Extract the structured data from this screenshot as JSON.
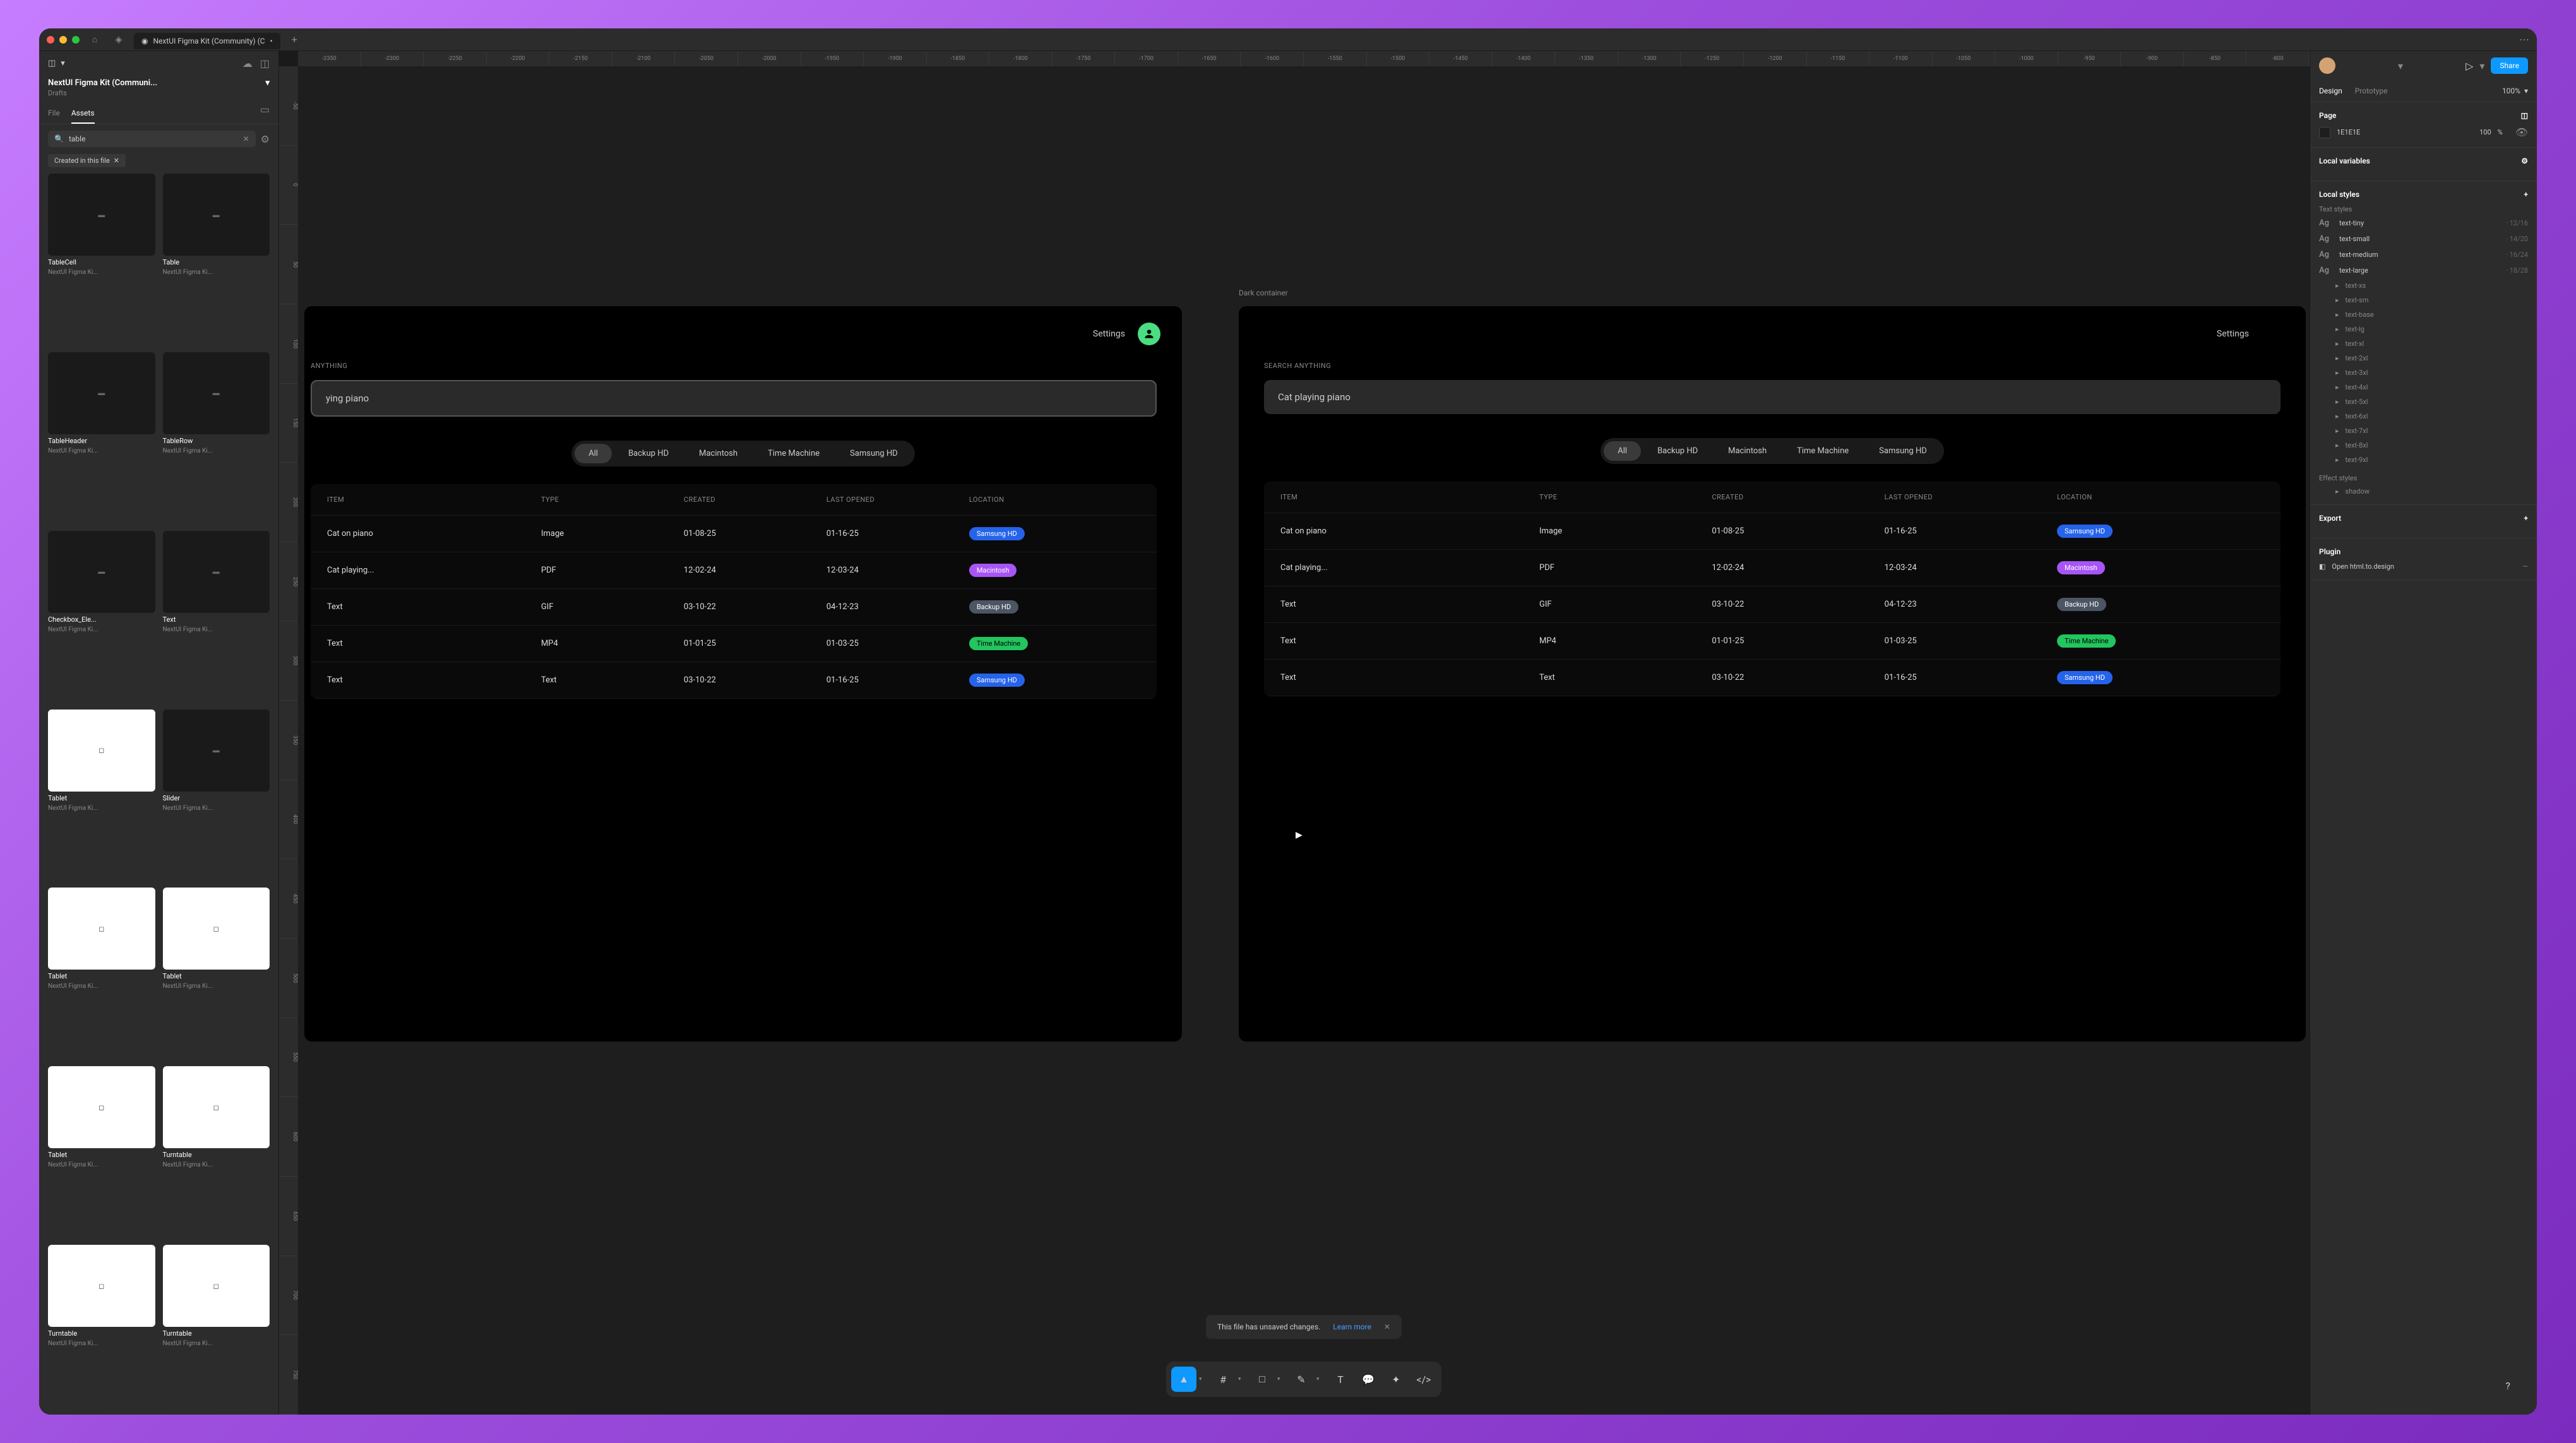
{
  "titlebar": {
    "tab_name": "NextUI Figma Kit (Community) (C",
    "tab_modified": "•"
  },
  "left_panel": {
    "project_name": "NextUI Figma Kit (Communi...",
    "project_location": "Drafts",
    "tabs": [
      "File",
      "Assets"
    ],
    "active_tab": 1,
    "search_value": "table",
    "chip": "Created in this file",
    "assets": [
      {
        "name": "TableCell",
        "sub": "NextUI Figma Ki...",
        "dark": true
      },
      {
        "name": "Table",
        "sub": "NextUI Figma Ki...",
        "dark": true
      },
      {
        "name": "TableHeader",
        "sub": "NextUI Figma Ki...",
        "dark": true
      },
      {
        "name": "TableRow",
        "sub": "NextUI Figma Ki...",
        "dark": true
      },
      {
        "name": "Checkbox_Ele...",
        "sub": "NextUI Figma Ki...",
        "dark": true
      },
      {
        "name": "Text",
        "sub": "NextUI Figma Ki...",
        "dark": true
      },
      {
        "name": "Tablet",
        "sub": "NextUI Figma Ki...",
        "light": true
      },
      {
        "name": "Slider",
        "sub": "NextUI Figma Ki...",
        "dark": true
      },
      {
        "name": "Tablet",
        "sub": "NextUI Figma Ki...",
        "light": true
      },
      {
        "name": "Tablet",
        "sub": "NextUI Figma Ki...",
        "light": true
      },
      {
        "name": "Tablet",
        "sub": "NextUI Figma Ki...",
        "light": true
      },
      {
        "name": "Turntable",
        "sub": "NextUI Figma Ki...",
        "light": true
      },
      {
        "name": "Turntable",
        "sub": "NextUI Figma Ki...",
        "light": true
      },
      {
        "name": "Turntable",
        "sub": "NextUI Figma Ki...",
        "light": true
      }
    ]
  },
  "ruler_h": [
    "-2350",
    "-2300",
    "-2250",
    "-2200",
    "-2150",
    "-2100",
    "-2050",
    "-2000",
    "-1950",
    "-1900",
    "-1850",
    "-1800",
    "-1750",
    "-1700",
    "-1650",
    "-1600",
    "-1550",
    "-1500",
    "-1450",
    "-1400",
    "-1350",
    "-1300",
    "-1250",
    "-1200",
    "-1150",
    "-1100",
    "-1050",
    "-1000",
    "-950",
    "-900",
    "-850",
    "-800"
  ],
  "ruler_v": [
    "-50",
    "0",
    "50",
    "100",
    "150",
    "200",
    "250",
    "300",
    "350",
    "400",
    "450",
    "500",
    "550",
    "600",
    "650",
    "700",
    "750"
  ],
  "canvas": {
    "c2_label": "Dark container",
    "settings_label": "Settings",
    "search_label": "SEARCH ANYTHING",
    "c1_search_label": "ANYTHING",
    "search_value_c1": "ying piano",
    "search_value_c2": "Cat playing piano",
    "filters": [
      "All",
      "Backup HD",
      "Macintosh",
      "Time Machine",
      "Samsung HD"
    ],
    "table": {
      "headers": [
        "ITEM",
        "TYPE",
        "CREATED",
        "LAST OPENED",
        "LOCATION"
      ],
      "rows": [
        {
          "item": "Cat on piano",
          "type": "Image",
          "created": "01-08-25",
          "opened": "01-16-25",
          "loc": "Samsung HD",
          "badge": "b-samsung"
        },
        {
          "item": "Cat playing...",
          "type": "PDF",
          "created": "12-02-24",
          "opened": "12-03-24",
          "loc": "Macintosh",
          "badge": "b-mac"
        },
        {
          "item": "Text",
          "type": "GIF",
          "created": "03-10-22",
          "opened": "04-12-23",
          "loc": "Backup HD",
          "badge": "b-backup"
        },
        {
          "item": "Text",
          "type": "MP4",
          "created": "01-01-25",
          "opened": "01-03-25",
          "loc": "Time Machine",
          "badge": "b-tm"
        },
        {
          "item": "Text",
          "type": "Text",
          "created": "03-10-22",
          "opened": "01-16-25",
          "loc": "Samsung HD",
          "badge": "b-samsung"
        }
      ]
    }
  },
  "toast": {
    "msg": "This file has unsaved changes.",
    "link": "Learn more"
  },
  "right_panel": {
    "share": "Share",
    "tabs": [
      "Design",
      "Prototype"
    ],
    "zoom": "100%",
    "page_label": "Page",
    "page_color": "1E1E1E",
    "page_opacity": "100",
    "pct": "%",
    "local_vars": "Local variables",
    "local_styles": "Local styles",
    "text_styles_label": "Text styles",
    "text_styles": [
      {
        "name": "text-tiny",
        "meta": "12/16"
      },
      {
        "name": "text-small",
        "meta": "14/20"
      },
      {
        "name": "text-medium",
        "meta": "16/24"
      },
      {
        "name": "text-large",
        "meta": "18/28"
      }
    ],
    "text_sizes": [
      "text-xs",
      "text-sm",
      "text-base",
      "text-lg",
      "text-xl",
      "text-2xl",
      "text-3xl",
      "text-4xl",
      "text-5xl",
      "text-6xl",
      "text-7xl",
      "text-8xl",
      "text-9xl"
    ],
    "effect_styles_label": "Effect styles",
    "effect_shadow": "shadow",
    "export_label": "Export",
    "plugin_label": "Plugin",
    "plugin_name": "Open html.to.design"
  }
}
